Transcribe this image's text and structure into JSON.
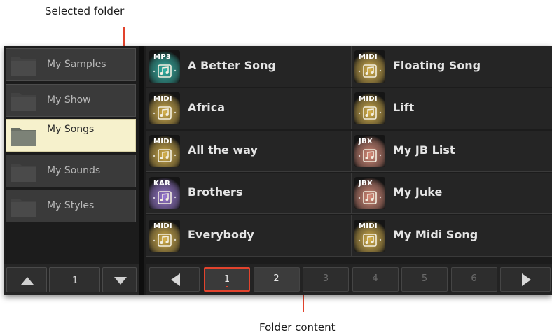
{
  "callouts": {
    "selected_folder": "Selected folder",
    "folder_content": "Folder content",
    "line_color": "#e2432d"
  },
  "folders": [
    {
      "label": "My Samples",
      "selected": false
    },
    {
      "label": "My Show",
      "selected": false
    },
    {
      "label": "My Songs",
      "selected": true
    },
    {
      "label": "My Sounds",
      "selected": false
    },
    {
      "label": "My Styles",
      "selected": false
    }
  ],
  "folder_nav": {
    "up_icon": "triangle-up-icon",
    "down_icon": "triangle-down-icon",
    "page": "1"
  },
  "songs": [
    {
      "name": "A Better Song",
      "type": "MP3",
      "tint": "#2fb3a6"
    },
    {
      "name": "Floating Song",
      "type": "MIDI",
      "tint": "#d8b24a"
    },
    {
      "name": "Africa",
      "type": "MIDI",
      "tint": "#d8b24a"
    },
    {
      "name": "Lift",
      "type": "MIDI",
      "tint": "#d8b24a"
    },
    {
      "name": "All the way",
      "type": "MIDI",
      "tint": "#d8b24a"
    },
    {
      "name": "My JB List",
      "type": "JBX",
      "tint": "#d98b78"
    },
    {
      "name": "Brothers",
      "type": "KAR",
      "tint": "#9b79d6"
    },
    {
      "name": "My Juke",
      "type": "JBX",
      "tint": "#d98b78"
    },
    {
      "name": "Everybody",
      "type": "MIDI",
      "tint": "#d8b24a"
    },
    {
      "name": "My Midi Song",
      "type": "MIDI",
      "tint": "#d8b24a"
    }
  ],
  "pagination": {
    "prev_icon": "triangle-left-icon",
    "next_icon": "triangle-right-icon",
    "current": "1",
    "pages": [
      "1",
      "2",
      "3",
      "4",
      "5",
      "6"
    ],
    "enabled_pages": [
      "1",
      "2"
    ]
  },
  "icons": {
    "folder": "folder-icon",
    "song": "music-note-icon"
  }
}
